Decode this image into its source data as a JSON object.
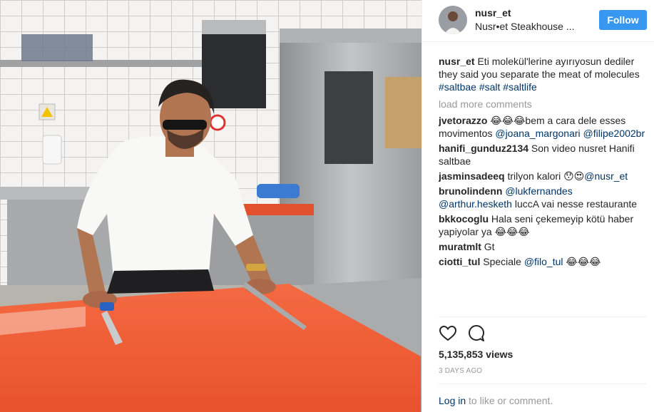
{
  "header": {
    "username": "nusr_et",
    "location": "Nusr•et Steakhouse ...",
    "follow_label": "Follow"
  },
  "caption": {
    "username": "nusr_et",
    "text": "Eti molekül'lerine ayırıyosun dediler they said you separate the meat of molecules",
    "hashtags": [
      "#saltbae",
      "#salt",
      "#saltlife"
    ]
  },
  "load_more": "load more comments",
  "comments": [
    {
      "user": "jvetorazzo",
      "parts": [
        {
          "text": "😂😂😂bem a cara dele esses movimentos "
        },
        {
          "tag": "@joana_margonari"
        },
        {
          "text": " "
        },
        {
          "tag": "@filipe2002br"
        }
      ]
    },
    {
      "user": "hanifi_gunduz2134",
      "parts": [
        {
          "text": "Son video nusret Hanifi saltbae"
        }
      ]
    },
    {
      "user": "jasminsadeeq",
      "parts": [
        {
          "text": "trilyon kalori 😯😍"
        },
        {
          "tag": "@nusr_et"
        }
      ]
    },
    {
      "user": "brunolindenn",
      "parts": [
        {
          "tag": "@lukfernandes"
        },
        {
          "text": " "
        },
        {
          "tag": "@arthur.hesketh"
        },
        {
          "text": " luccA vai nesse restaurante"
        }
      ]
    },
    {
      "user": "bkkocoglu",
      "parts": [
        {
          "text": "Hala seni çekemeyip kötü haber yapiyolar ya 😂😂😂"
        }
      ]
    },
    {
      "user": "muratmlt",
      "parts": [
        {
          "text": "Gt"
        }
      ]
    },
    {
      "user": "ciotti_tul",
      "parts": [
        {
          "text": "Speciale "
        },
        {
          "tag": "@filo_tul"
        },
        {
          "text": " 😂😂😂"
        }
      ]
    }
  ],
  "actions": {
    "like_icon": "heart-icon",
    "comment_icon": "comment-bubble-icon"
  },
  "views": "5,135,853 views",
  "time_ago": "3 DAYS AGO",
  "login": {
    "link": "Log in",
    "rest": " to like or comment."
  },
  "colors": {
    "accent": "#3897f0",
    "link": "#003569",
    "muted": "#999999",
    "cutting_board": "#f05a32"
  }
}
